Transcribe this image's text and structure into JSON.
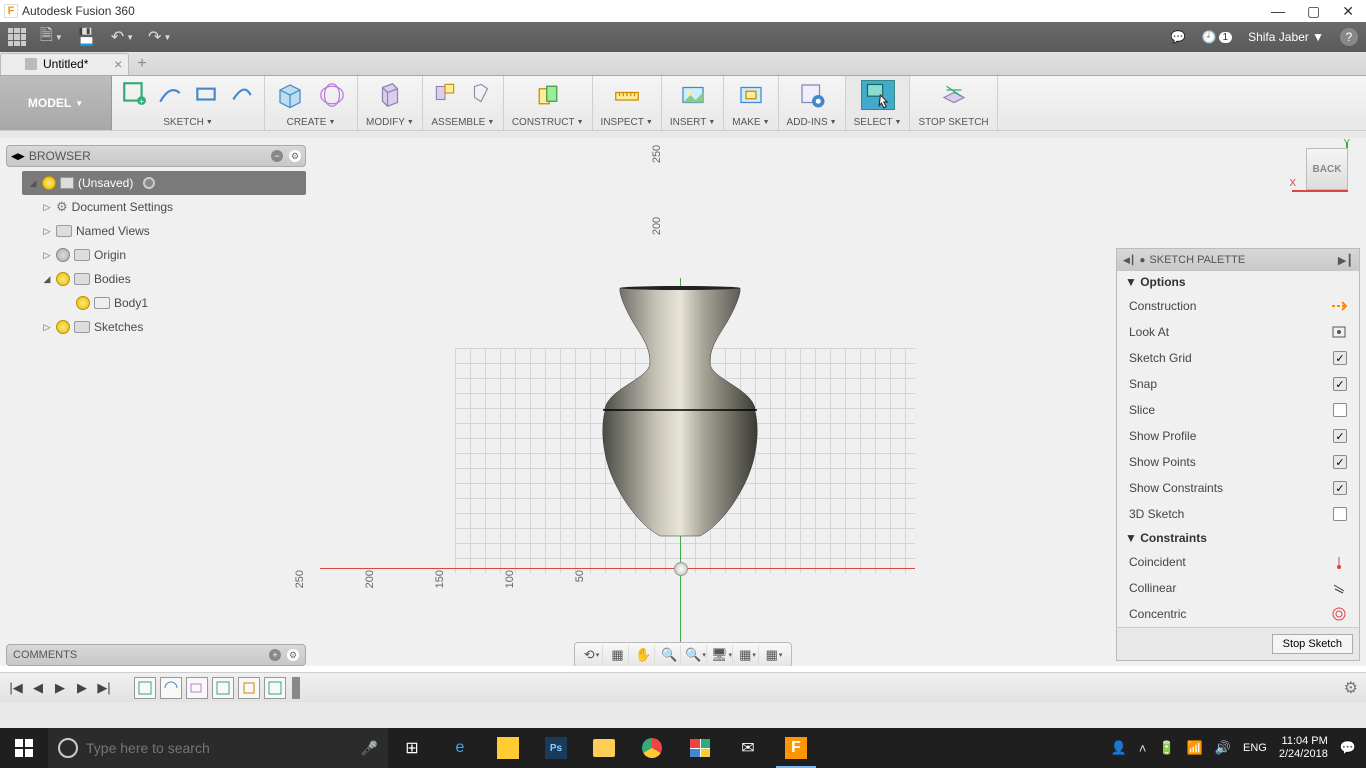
{
  "app": {
    "title": "Autodesk Fusion 360"
  },
  "qat": {
    "user": "Shifa Jaber",
    "notif_count": "1"
  },
  "tabs": {
    "current": "Untitled*"
  },
  "workspace": {
    "label": "MODEL"
  },
  "ribbon": {
    "groups": [
      {
        "label": "SKETCH"
      },
      {
        "label": "CREATE"
      },
      {
        "label": "MODIFY"
      },
      {
        "label": "ASSEMBLE"
      },
      {
        "label": "CONSTRUCT"
      },
      {
        "label": "INSPECT"
      },
      {
        "label": "INSERT"
      },
      {
        "label": "MAKE"
      },
      {
        "label": "ADD-INS"
      },
      {
        "label": "SELECT"
      },
      {
        "label": "STOP SKETCH"
      }
    ]
  },
  "browser": {
    "title": "BROWSER",
    "root": "(Unsaved)",
    "items": [
      {
        "label": "Document Settings"
      },
      {
        "label": "Named Views"
      },
      {
        "label": "Origin"
      },
      {
        "label": "Bodies"
      },
      {
        "label": "Body1"
      },
      {
        "label": "Sketches"
      }
    ]
  },
  "viewcube": {
    "face": "BACK"
  },
  "axis_ticks": {
    "y": [
      "250",
      "200"
    ],
    "x": [
      "250",
      "200",
      "150",
      "100",
      "50"
    ]
  },
  "palette": {
    "title": "SKETCH PALETTE",
    "sections": {
      "options": "Options",
      "constraints": "Constraints"
    },
    "options": [
      {
        "label": "Construction",
        "type": "icon"
      },
      {
        "label": "Look At",
        "type": "icon"
      },
      {
        "label": "Sketch Grid",
        "type": "check",
        "checked": true
      },
      {
        "label": "Snap",
        "type": "check",
        "checked": true
      },
      {
        "label": "Slice",
        "type": "check",
        "checked": false
      },
      {
        "label": "Show Profile",
        "type": "check",
        "checked": true
      },
      {
        "label": "Show Points",
        "type": "check",
        "checked": true
      },
      {
        "label": "Show Constraints",
        "type": "check",
        "checked": true
      },
      {
        "label": "3D Sketch",
        "type": "check",
        "checked": false
      }
    ],
    "constraints": [
      {
        "label": "Coincident"
      },
      {
        "label": "Collinear"
      },
      {
        "label": "Concentric"
      }
    ],
    "stop_button": "Stop Sketch"
  },
  "comments": {
    "title": "COMMENTS"
  },
  "taskbar": {
    "search_placeholder": "Type here to search",
    "lang": "ENG",
    "time": "11:04 PM",
    "date": "2/24/2018"
  }
}
